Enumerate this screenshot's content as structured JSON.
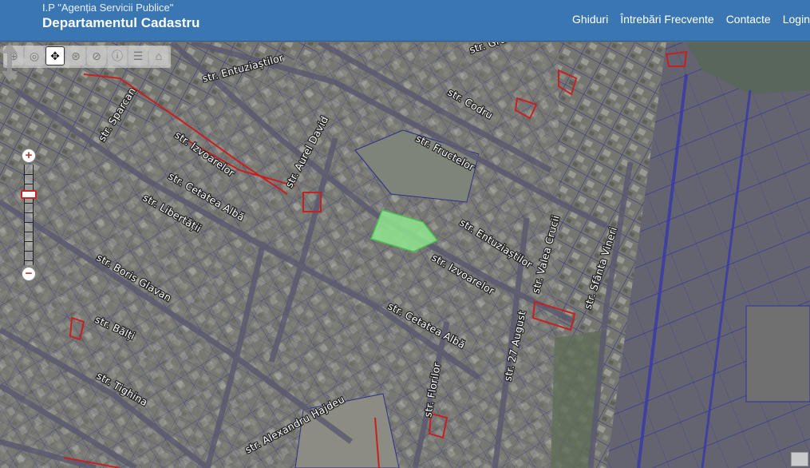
{
  "header": {
    "org_name": "I.P \"Agenția Servicii Publice\"",
    "department": "Departamentul Cadastru",
    "nav": [
      "Ghiduri",
      "Întrebări Frecvente",
      "Contacte",
      "Login"
    ]
  },
  "toolbar": {
    "tools": [
      "zoom-in-tool-icon",
      "zoom-out-tool-icon",
      "pan-tool-icon",
      "identify-tool-icon",
      "measure-tool-icon",
      "info-tool-icon",
      "layers-tool-icon",
      "home-tool-icon"
    ],
    "active_tool": "pan-tool-icon"
  },
  "zoom": {
    "plus": "+",
    "minus": "−"
  },
  "streets": [
    "str. Grădinilor",
    "str. Entuziaștilor",
    "str. Codru",
    "str. Sparcan",
    "str. Izvoarelor",
    "str. Aurel David",
    "str. Fructelor",
    "str. Cetatea Albă",
    "str. Libertății",
    "str. Entuziaștilor",
    "str. Valea Crucii",
    "str. Sfânta Vineri",
    "str. Izvoarelor",
    "str. Boris Glavan",
    "str. Cetatea Albă",
    "str. 27 August",
    "str. Bălți",
    "str. Florilor",
    "str. Tighina",
    "str. Alexandru Hajdeu"
  ],
  "colors": {
    "header_bg": "#3a76b1",
    "parcel_line": "#2a2d9a",
    "registered_parcel": "#c62020",
    "selected_parcel": "#8ee68e"
  }
}
